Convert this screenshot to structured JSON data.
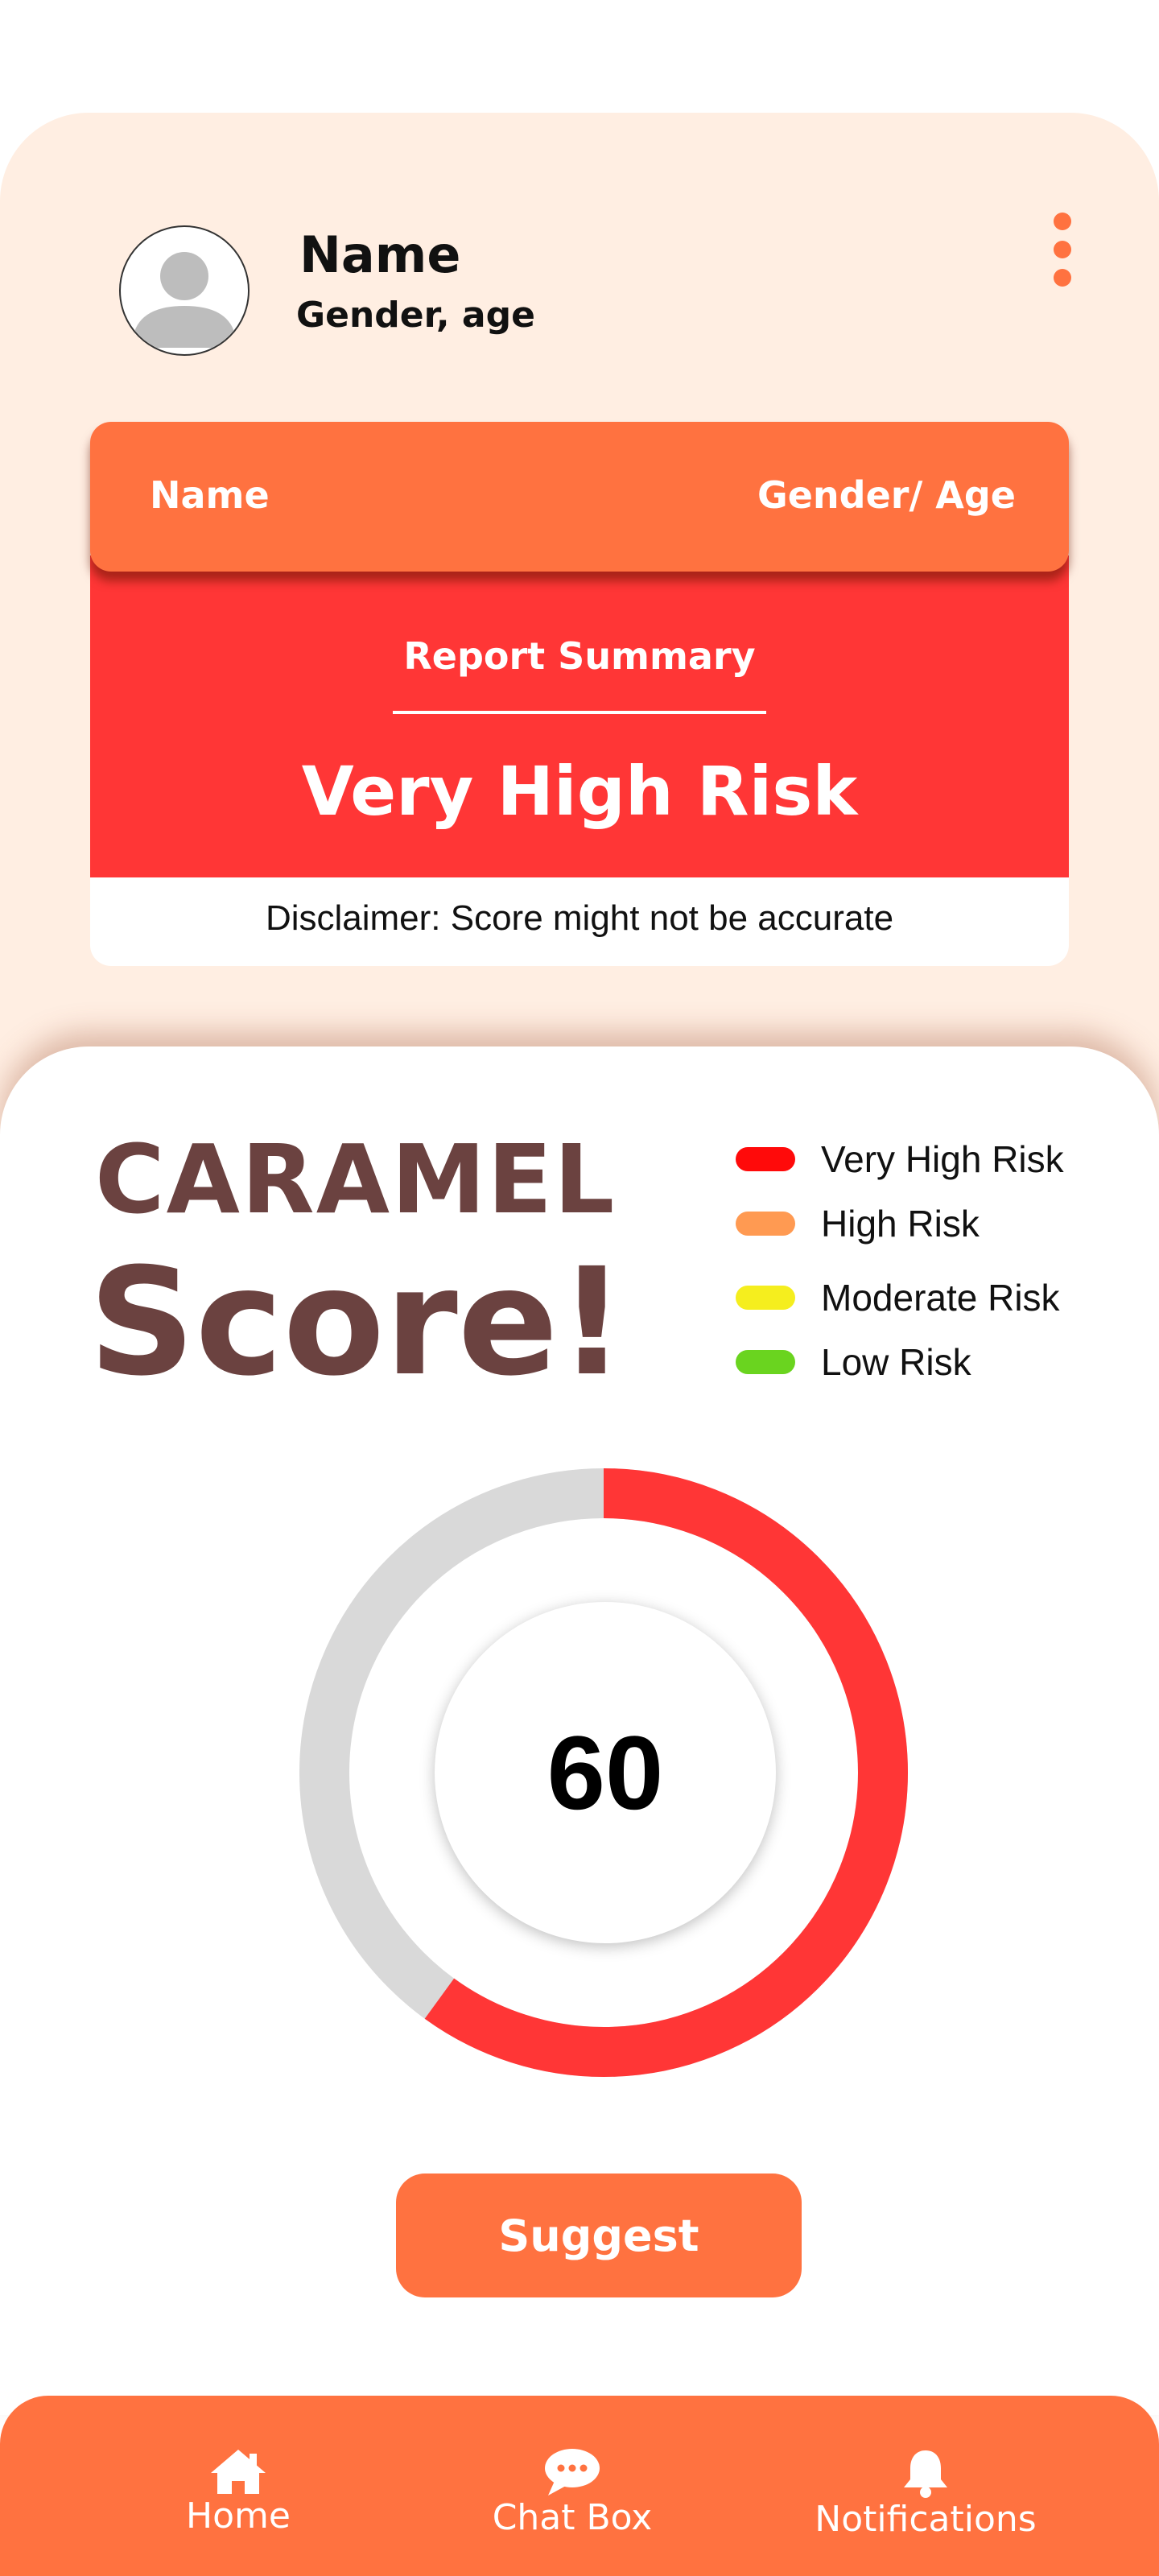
{
  "profile": {
    "name": "Name",
    "subtitle": "Gender, age",
    "menu_icon": "more-vertical-icon"
  },
  "report": {
    "header_left": "Name",
    "header_right": "Gender/ Age",
    "summary_label": "Report Summary",
    "risk_level": "Very High Risk",
    "disclaimer": "Disclaimer: Score might not be accurate"
  },
  "score_section": {
    "brand": "CARAMEL",
    "heading": "Score!",
    "legend": [
      {
        "label": "Very High Risk",
        "color": "#ff0a0a"
      },
      {
        "label": "High Risk",
        "color": "#ff9a52"
      },
      {
        "label": "Moderate Risk",
        "color": "#f5ee1e"
      },
      {
        "label": "Low Risk",
        "color": "#6ad41f"
      }
    ],
    "gauge": {
      "value": "60",
      "fill_fraction": 0.6,
      "fill_color": "#ff3636",
      "track_color": "#d9d9d9"
    }
  },
  "suggest_button": "Suggest",
  "nav": [
    {
      "label": "Home",
      "icon": "home-icon"
    },
    {
      "label": "Chat Box",
      "icon": "chat-bubble-icon"
    },
    {
      "label": "Notifications",
      "icon": "bell-icon"
    }
  ],
  "colors": {
    "accent": "#ff7240",
    "danger": "#ff3636",
    "background": "#ffeee2",
    "brand_text": "#6b4240"
  }
}
